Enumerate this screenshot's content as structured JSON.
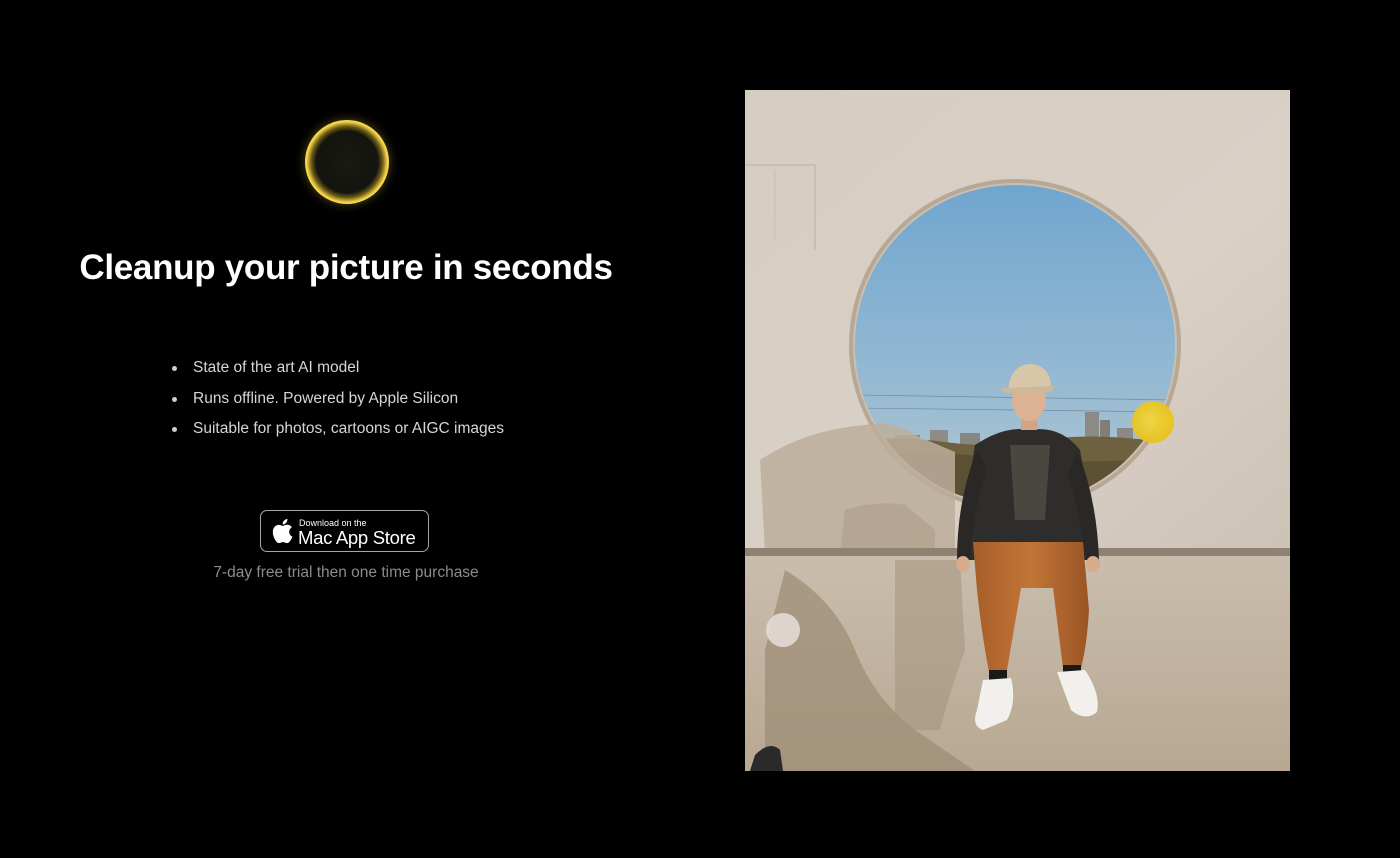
{
  "app": {
    "headline": "Cleanup your picture in seconds"
  },
  "features": {
    "items": [
      "State of the art AI model",
      "Runs offline. Powered by Apple Silicon",
      "Suitable for photos, cartoons or AIGC images"
    ]
  },
  "store_badge": {
    "small_text": "Download on the",
    "large_text": "Mac App Store",
    "icon": "apple-icon"
  },
  "trial_note": "7-day free trial then one time purchase",
  "logo": {
    "icon": "cleanup-logo-icon",
    "accent_color": "#f5d54a"
  },
  "photo": {
    "icon": "demo-photo",
    "brush_color": "#f7d117"
  }
}
